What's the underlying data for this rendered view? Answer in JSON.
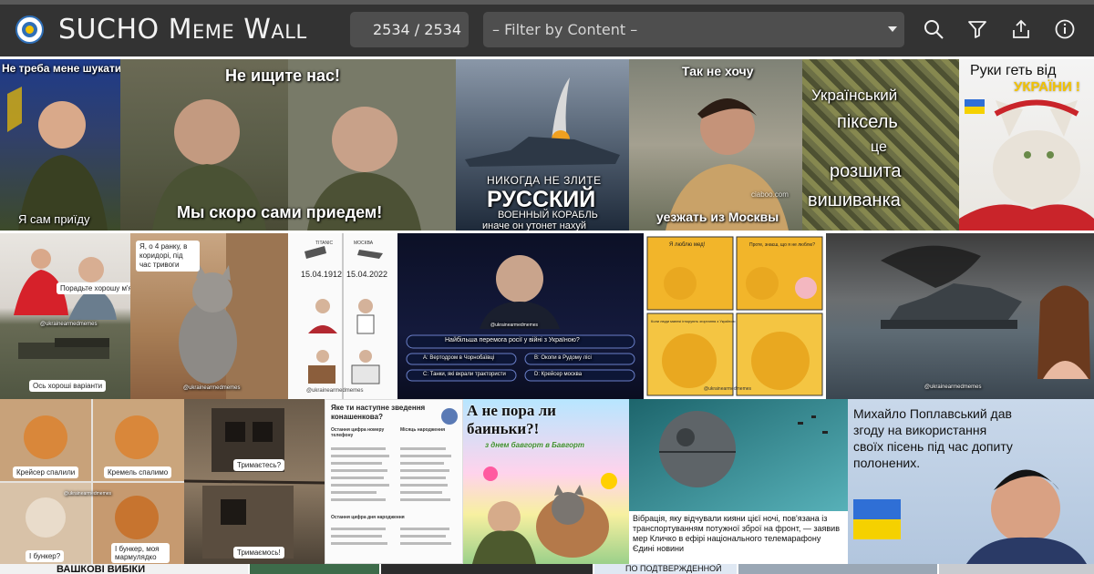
{
  "header": {
    "app_title": "SUCHO Meme Wall",
    "counter": "2534 / 2534",
    "filter_label": "– Filter by Content –",
    "icons": [
      "search-icon",
      "filter-icon",
      "share-icon",
      "info-icon"
    ]
  },
  "memes": {
    "m1": {
      "top": "Не треба мене шукати",
      "bottom": "Я сам приїду"
    },
    "m2": {
      "top": "Не ищите нас!",
      "bottom": "Мы скоро сами приедем!"
    },
    "m3": {
      "line1": "НИКОГДА НЕ ЗЛИТЕ",
      "line2": "РУССКИЙ",
      "line3": "ВОЕННЫЙ КОРАБЛЬ",
      "line4": "иначе он утонет нахуй"
    },
    "m4": {
      "top": "Так не хочу",
      "bottom": "уезжать из Москвы",
      "watermark": "ciaboo.com"
    },
    "m5": {
      "l1": "Український",
      "l2": "піксель",
      "l3": "це",
      "l4": "розшита",
      "l5": "вишиванка"
    },
    "m6": {
      "l1": "Руки геть від",
      "l2": "УКРАЇНИ !"
    },
    "m7": {
      "top": "Порадьте хорошу м'ясорубку",
      "bottom": "Ось хороші варіанти",
      "watermark": "@ukrainearmedmemes"
    },
    "m8": {
      "text": "Я, о 4 ранку, в коридорі, під час тривоги",
      "watermark": "@ukrainearmedmemes"
    },
    "m9": {
      "top_left": "TITANIC",
      "top_right": "МОСКВА",
      "date_left": "15.04.1912",
      "date_right": "15.04.2022",
      "watermark": "@ukrainearmedmemes"
    },
    "m10": {
      "watermark": "@ukrainearmedmemes",
      "question": "Найбільша перемога росії у війні з Україною?",
      "a": "A: Вертодром в Чорнобаївці",
      "b": "B: Окопи в Рудому лісі",
      "c": "C: Танки, які вкрали трактористи",
      "d": "D: Крейсер москва"
    },
    "m11": {
      "q1": "Я люблю мед!",
      "q2": "Проте, знаєш, що я не люблю?",
      "q3": "Коли люди манекі ігнорують згортання з Україною",
      "watermark": "@ukrainearmedmemes"
    },
    "m12": {
      "watermark": "@ukrainearmedmemes"
    },
    "m13": {
      "a": "Крейсер спалили",
      "b": "Кремель спалимо",
      "c": "І бункер?",
      "d": "І бункер, моя мармулядко",
      "watermark": "@ukrainearmedmemes"
    },
    "m14": {
      "a": "Тримаєтесь?",
      "b": "Тримаємось!"
    },
    "m15": {
      "title": "Яке ти наступне зведення конашенкова?",
      "col1": "Остання цифра номеру телефону",
      "col2": "Місяць народження",
      "col3": "Остання цифра дня народження"
    },
    "m16": {
      "top": "А не пора ли баиньки?!",
      "bottom": "з днем бавгорт в Бавгорт"
    },
    "m17": {
      "text": "Вібрація, яку відчували кияни цієї ночі, пов'язана із транспортуванням потужної зброї на фронт, — заявив мер Кличко в ефірі національного телемарафону Єдині новини"
    },
    "m18": {
      "text": "Михайло Поплавський дав згоду на використання своїх пісень під час допиту полонених."
    },
    "bottom_strip": {
      "a": "ВАШКОВІ ВИБІКИ",
      "b": "ПО ПОДТВЕРЖДЕННОЙ"
    }
  },
  "colors": {
    "header_bg": "#333333",
    "control_bg": "#4e4e4e",
    "page_bg": "#ffffff"
  }
}
